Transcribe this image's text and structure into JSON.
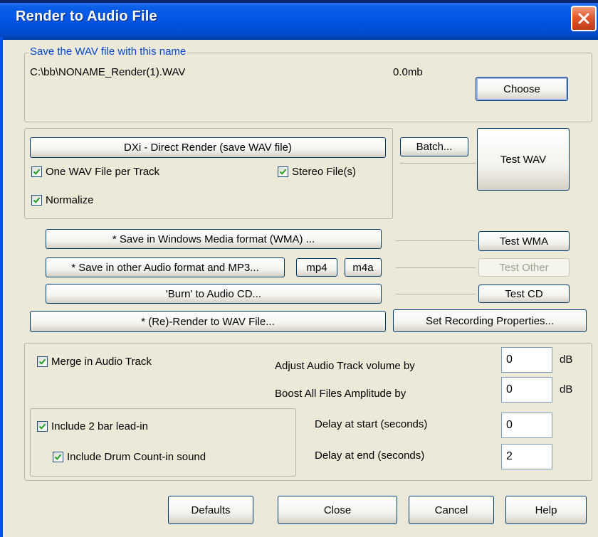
{
  "window": {
    "title": "Render to Audio File"
  },
  "save_group": {
    "legend": "Save the WAV file with this name",
    "path": "C:\\bb\\NONAME_Render(1).WAV",
    "size": "0.0mb",
    "choose_label": "Choose"
  },
  "dxi_group": {
    "direct_render_label": "DXi - Direct Render (save WAV file)",
    "batch_label": "Batch...",
    "test_wav_label": "Test WAV",
    "one_wav_label": "One WAV File per Track",
    "stereo_label": "Stereo File(s)",
    "normalize_label": "Normalize",
    "one_wav_checked": true,
    "stereo_checked": true,
    "normalize_checked": true
  },
  "formats": {
    "wma_label": "* Save in Windows Media format (WMA) ...",
    "test_wma_label": "Test WMA",
    "other_label": "* Save in other Audio format and MP3...",
    "mp4_label": "mp4",
    "m4a_label": "m4a",
    "test_other_label": "Test Other",
    "burn_label": "'Burn' to Audio CD...",
    "test_cd_label": "Test CD",
    "rerender_label": "* (Re)-Render to WAV File...",
    "set_recording_label": "Set Recording Properties..."
  },
  "options": {
    "merge_label": "Merge in Audio Track",
    "merge_checked": true,
    "adjust_label": "Adjust Audio Track volume by",
    "adjust_value": "0",
    "adjust_unit": "dB",
    "boost_label": "Boost All Files Amplitude by",
    "boost_value": "0",
    "boost_unit": "dB",
    "leadin_label": "Include 2 bar lead-in",
    "leadin_checked": true,
    "drum_label": "Include Drum Count-in sound",
    "drum_checked": true,
    "delay_start_label": "Delay at start (seconds)",
    "delay_start_value": "0",
    "delay_end_label": "Delay at end (seconds)",
    "delay_end_value": "2"
  },
  "footer": {
    "defaults_label": "Defaults",
    "close_label": "Close",
    "cancel_label": "Cancel",
    "help_label": "Help"
  }
}
